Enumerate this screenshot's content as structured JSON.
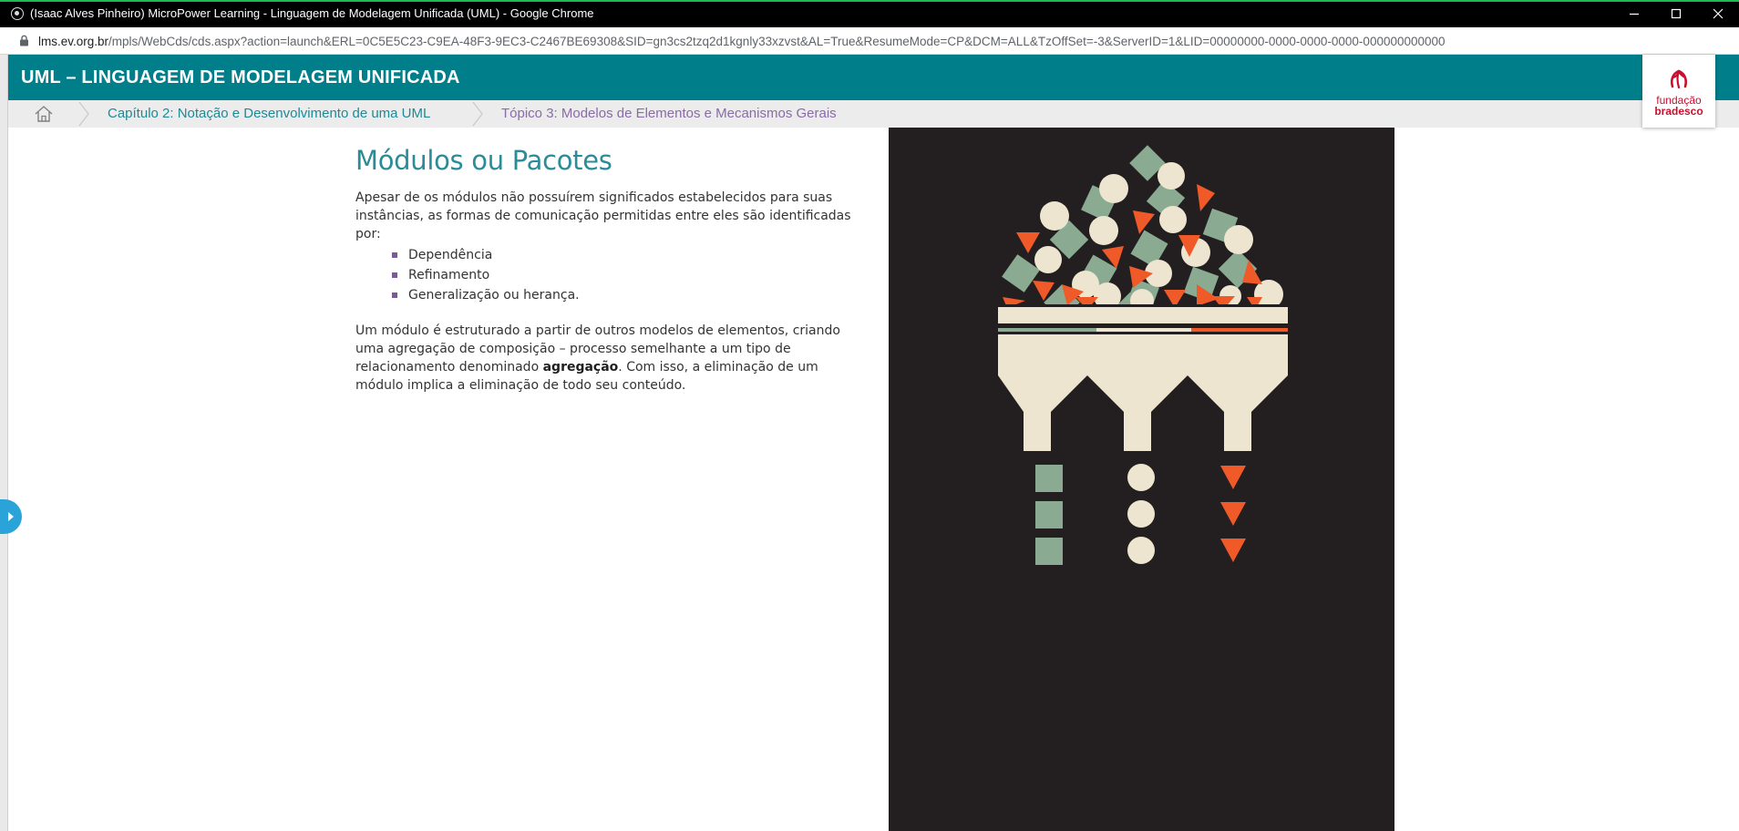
{
  "window": {
    "title": "(Isaac Alves Pinheiro) MicroPower Learning - Linguagem de Modelagem Unificada (UML) - Google Chrome"
  },
  "address": {
    "host": "lms.ev.org.br",
    "path": "/mpls/WebCds/cds.aspx?action=launch&ERL=0C5E5C23-C9EA-48F3-9EC3-C2467BE69308&SID=gn3cs2tzq2d1kgnly33xzvst&AL=True&ResumeMode=CP&DCM=ALL&TzOffSet=-3&ServerID=1&LID=00000000-0000-0000-0000-000000000000"
  },
  "course": {
    "title": "UML – LINGUAGEM DE MODELAGEM UNIFICADA"
  },
  "breadcrumb": {
    "chapter": "Capítulo 2: Notação e Desenvolvimento de uma UML",
    "topic": "Tópico 3: Modelos de Elementos e Mecanismos Gerais"
  },
  "logo": {
    "line1": "fundação",
    "line2": "bradesco"
  },
  "main": {
    "heading": "Módulos ou Pacotes",
    "intro": "Apesar de os módulos não possuírem significados estabelecidos para suas instâncias, as formas de comunicação permitidas entre eles são identificadas por:",
    "bullets": [
      "Dependência",
      "Refinamento",
      "Generalização ou herança."
    ],
    "para2_before": "Um módulo é estruturado a partir de outros modelos de elementos, criando uma agregação de composição – processo semelhante a um tipo de relacionamento denominado ",
    "para2_bold": "agregação",
    "para2_after": ". Com isso, a eliminação de um módulo implica a eliminação de todo seu conteúdo."
  },
  "colors": {
    "header": "#007f8b",
    "heading": "#2a8c99",
    "breadcrumb_chapter": "#1d8a96",
    "breadcrumb_topic": "#8a6aa8",
    "illustration_bg": "#231f20",
    "shape_green": "#8aaa92",
    "shape_cream": "#ede5d0",
    "shape_orange": "#ef5a28",
    "logo_red": "#c8102e"
  },
  "icons": {
    "lock": "lock-icon",
    "home": "home-icon",
    "minimize": "minimize-icon",
    "maximize": "maximize-icon",
    "close": "close-icon",
    "side_handle": "chevron-right-icon"
  }
}
